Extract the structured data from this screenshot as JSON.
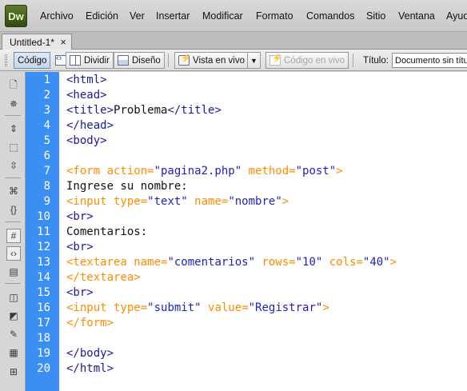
{
  "app": {
    "logo": "Dw"
  },
  "menu": [
    "Archivo",
    "Edición",
    "Ver",
    "Insertar",
    "Modificar",
    "Formato",
    "Comandos",
    "Sitio",
    "Ventana",
    "Ayuda"
  ],
  "document_tab": {
    "label": "Untitled-1*",
    "close": "×"
  },
  "toolbar": {
    "code_label": "Código",
    "split_label": "Dividir",
    "design_label": "Diseño",
    "live_view_label": "Vista en vivo",
    "live_code_label": "Código en vivo",
    "title_label": "Título:",
    "title_value": "Documento sin título"
  },
  "editor": {
    "lines": [
      {
        "n": "1",
        "parts": [
          [
            "t",
            "<html>"
          ]
        ]
      },
      {
        "n": "2",
        "parts": [
          [
            "t",
            "<head>"
          ]
        ]
      },
      {
        "n": "3",
        "parts": [
          [
            "t",
            "<title>"
          ],
          [
            "x",
            "Problema"
          ],
          [
            "t",
            "</title>"
          ]
        ]
      },
      {
        "n": "4",
        "parts": [
          [
            "t",
            "</head>"
          ]
        ]
      },
      {
        "n": "5",
        "parts": [
          [
            "t",
            "<body>"
          ]
        ]
      },
      {
        "n": "6",
        "parts": []
      },
      {
        "n": "7",
        "parts": [
          [
            "f",
            "<form action="
          ],
          [
            "v",
            "\"pagina2.php\""
          ],
          [
            "f",
            " method="
          ],
          [
            "v",
            "\"post\""
          ],
          [
            "f",
            ">"
          ]
        ]
      },
      {
        "n": "8",
        "parts": [
          [
            "x",
            "Ingrese su nombre:"
          ]
        ]
      },
      {
        "n": "9",
        "parts": [
          [
            "f",
            "<input type="
          ],
          [
            "v",
            "\"text\""
          ],
          [
            "f",
            " name="
          ],
          [
            "v",
            "\"nombre\""
          ],
          [
            "f",
            ">"
          ]
        ]
      },
      {
        "n": "10",
        "parts": [
          [
            "t",
            "<br>"
          ]
        ]
      },
      {
        "n": "11",
        "parts": [
          [
            "x",
            "Comentarios:"
          ]
        ]
      },
      {
        "n": "12",
        "parts": [
          [
            "t",
            "<br>"
          ]
        ]
      },
      {
        "n": "13",
        "parts": [
          [
            "f",
            "<textarea name="
          ],
          [
            "v",
            "\"comentarios\""
          ],
          [
            "f",
            " rows="
          ],
          [
            "v",
            "\"10\""
          ],
          [
            "f",
            " cols="
          ],
          [
            "v",
            "\"40\""
          ],
          [
            "f",
            ">"
          ]
        ]
      },
      {
        "n": "14",
        "parts": [
          [
            "f",
            "</textarea>"
          ]
        ]
      },
      {
        "n": "15",
        "parts": [
          [
            "t",
            "<br>"
          ]
        ]
      },
      {
        "n": "16",
        "parts": [
          [
            "f",
            "<input type="
          ],
          [
            "v",
            "\"submit\""
          ],
          [
            "f",
            " value="
          ],
          [
            "v",
            "\"Registrar\""
          ],
          [
            "f",
            ">"
          ]
        ]
      },
      {
        "n": "17",
        "parts": [
          [
            "f",
            "</form>"
          ]
        ]
      },
      {
        "n": "18",
        "parts": []
      },
      {
        "n": "19",
        "parts": [
          [
            "t",
            "</body>"
          ]
        ]
      },
      {
        "n": "20",
        "parts": [
          [
            "t",
            "</html>"
          ]
        ]
      }
    ]
  },
  "colors": {
    "gutter": "#3b8ef2",
    "tag": "#1a1a9e",
    "form_tag": "#ff8c00",
    "value": "#1f1fbf"
  },
  "left_tool_icons": [
    "open-documents-icon",
    "show-code-navigator-icon",
    "collapse-full-tag-icon",
    "collapse-selection-icon",
    "expand-all-icon",
    "select-parent-tag-icon",
    "balance-braces-icon",
    "line-numbers-icon",
    "highlight-invalid-code-icon",
    "syntax-coloring-icon",
    "apply-comment-icon",
    "remove-comment-icon",
    "wrap-tag-icon",
    "recent-snippets-icon",
    "move-css-icon",
    "indent-code-icon"
  ]
}
